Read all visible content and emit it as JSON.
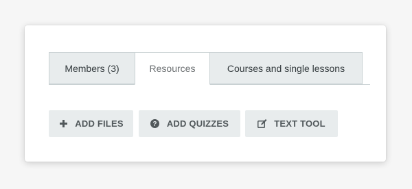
{
  "tabs": {
    "members_label": "Members (3)",
    "resources_label": "Resources",
    "courses_label": "Courses and single lessons",
    "active": "Resources"
  },
  "actions": {
    "add_files_label": "ADD FILES",
    "add_files_icon": "plus-icon",
    "add_quizzes_label": "ADD QUIZZES",
    "add_quizzes_icon": "question-circle-icon",
    "text_tool_label": "TEXT TOOL",
    "text_tool_icon": "edit-icon"
  },
  "colors": {
    "button_bg": "#e8eced",
    "tab_inactive_bg": "#e8eced",
    "tab_border": "#c9d1d3",
    "button_text": "#51585b"
  }
}
